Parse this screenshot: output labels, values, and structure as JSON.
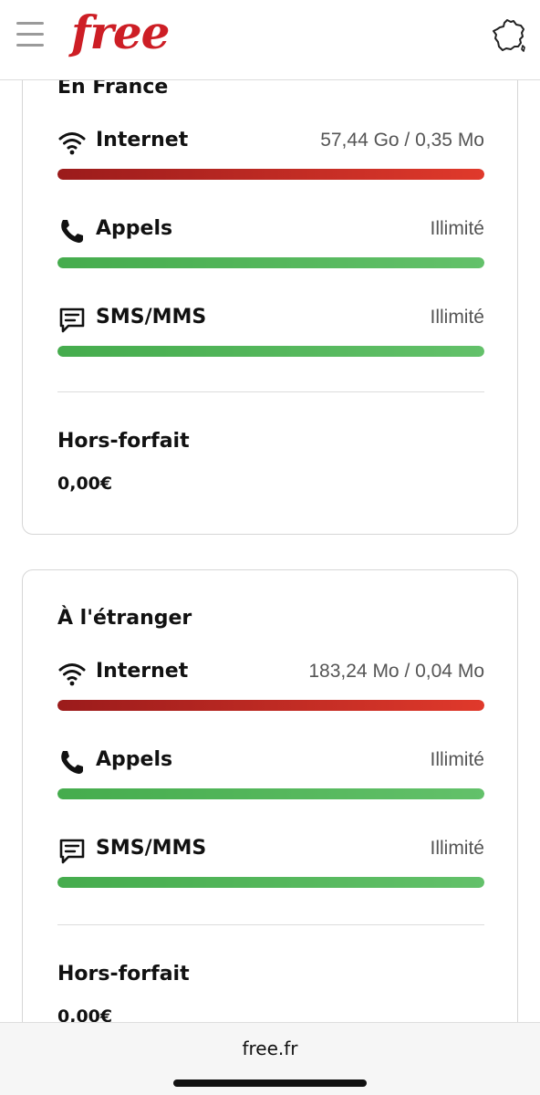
{
  "header": {
    "logo_text": "free",
    "brand_color": "#cd1e25"
  },
  "sections": [
    {
      "title": "En France",
      "rows": [
        {
          "icon": "wifi-icon",
          "label": "Internet",
          "value": "57,44 Go / 0,35 Mo",
          "bar_color": "red",
          "fill_percent": 100
        },
        {
          "icon": "phone-icon",
          "label": "Appels",
          "value": "Illimité",
          "bar_color": "green",
          "fill_percent": 100
        },
        {
          "icon": "sms-icon",
          "label": "SMS/MMS",
          "value": "Illimité",
          "bar_color": "green",
          "fill_percent": 100
        }
      ],
      "extra_title": "Hors-forfait",
      "extra_value": "0,00€"
    },
    {
      "title": "À l'étranger",
      "rows": [
        {
          "icon": "wifi-icon",
          "label": "Internet",
          "value": "183,24 Mo / 0,04 Mo",
          "bar_color": "red",
          "fill_percent": 100
        },
        {
          "icon": "phone-icon",
          "label": "Appels",
          "value": "Illimité",
          "bar_color": "green",
          "fill_percent": 100
        },
        {
          "icon": "sms-icon",
          "label": "SMS/MMS",
          "value": "Illimité",
          "bar_color": "green",
          "fill_percent": 100
        }
      ],
      "extra_title": "Hors-forfait",
      "extra_value": "0,00€"
    }
  ],
  "browser": {
    "url": "free.fr"
  }
}
